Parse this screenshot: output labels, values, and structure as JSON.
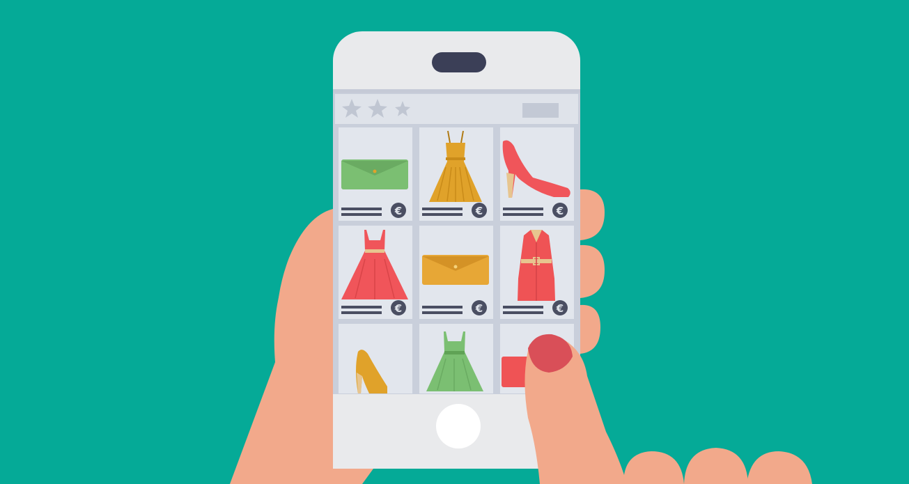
{
  "scene": {
    "background_color": "#05aa97",
    "skin_color": "#f2a98b",
    "nail_color": "#d94f58",
    "phone_body_color": "#e9eaec",
    "screen_color": "#d8dde6",
    "speaker_color": "#3b3f57"
  },
  "app": {
    "rating_icons": [
      "star-icon",
      "star-icon",
      "star-icon"
    ],
    "currency_icon": "euro-icon",
    "currency_symbol": "€",
    "products": [
      {
        "item": "clutch-bag",
        "color": "#7bbf72"
      },
      {
        "item": "dress",
        "color": "#e0a22a"
      },
      {
        "item": "high-heel",
        "color": "#f0555a"
      },
      {
        "item": "dress",
        "color": "#f0555a"
      },
      {
        "item": "clutch-bag",
        "color": "#e7a736"
      },
      {
        "item": "coat",
        "color": "#ef5355"
      },
      {
        "item": "high-heel",
        "color": "#e0a22a"
      },
      {
        "item": "dress",
        "color": "#7bbf72"
      },
      {
        "item": "bag",
        "color": "#ef5355"
      }
    ]
  }
}
